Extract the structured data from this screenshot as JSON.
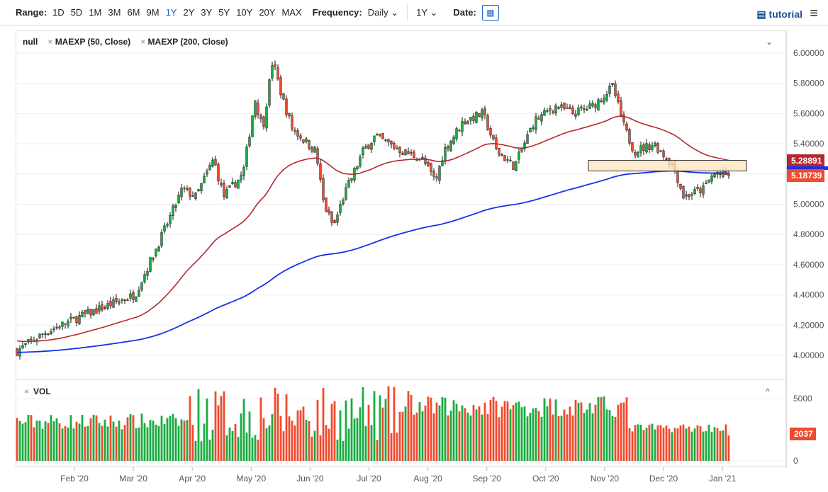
{
  "toolbar": {
    "range_label": "Range:",
    "ranges": [
      "1D",
      "5D",
      "1M",
      "3M",
      "6M",
      "9M",
      "1Y",
      "2Y",
      "3Y",
      "5Y",
      "10Y",
      "20Y",
      "MAX"
    ],
    "active_range": "1Y",
    "frequency_label": "Frequency:",
    "frequency": "Daily",
    "period": "1Y",
    "date_label": "Date:",
    "tutorial": "tutorial"
  },
  "legend": {
    "symbol": "null",
    "ma50": "MAEXP (50, Close)",
    "ma200": "MAEXP (200, Close)",
    "volume": "VOL"
  },
  "tags": {
    "ma50": "5.28891",
    "last": "5.18739",
    "volume": "2037"
  },
  "colors": {
    "up": "#1aab40",
    "down": "#f04a2f",
    "ma50": "#b5272d",
    "ma200": "#1533e8"
  },
  "chart_data": {
    "type": "candlestick",
    "y_ticks": [
      "6.00000",
      "5.80000",
      "5.60000",
      "5.40000",
      "5.20000",
      "5.00000",
      "4.80000",
      "4.60000",
      "4.40000",
      "4.20000",
      "4.00000"
    ],
    "ylim": [
      3.98,
      6.05
    ],
    "vol_ticks": [
      "5000",
      "0"
    ],
    "x_ticks": [
      "Feb '20",
      "Mar '20",
      "Apr '20",
      "May '20",
      "Jun '20",
      "Jul '20",
      "Aug '20",
      "Sep '20",
      "Oct '20",
      "Nov '20",
      "Dec '20",
      "Jan '21"
    ],
    "price_path_day_close": [
      [
        0,
        4.03
      ],
      [
        14,
        4.15
      ],
      [
        31,
        4.25
      ],
      [
        50,
        4.35
      ],
      [
        60,
        4.4
      ],
      [
        74,
        4.8
      ],
      [
        84,
        5.1
      ],
      [
        91,
        5.05
      ],
      [
        100,
        5.3
      ],
      [
        105,
        5.05
      ],
      [
        115,
        5.2
      ],
      [
        121,
        5.7
      ],
      [
        125,
        5.5
      ],
      [
        130,
        5.95
      ],
      [
        135,
        5.7
      ],
      [
        140,
        5.5
      ],
      [
        152,
        5.35
      ],
      [
        156,
        5.0
      ],
      [
        161,
        4.85
      ],
      [
        166,
        5.05
      ],
      [
        176,
        5.35
      ],
      [
        182,
        5.45
      ],
      [
        196,
        5.35
      ],
      [
        206,
        5.3
      ],
      [
        213,
        5.15
      ],
      [
        217,
        5.35
      ],
      [
        227,
        5.55
      ],
      [
        237,
        5.6
      ],
      [
        244,
        5.35
      ],
      [
        253,
        5.25
      ],
      [
        263,
        5.55
      ],
      [
        274,
        5.65
      ],
      [
        283,
        5.6
      ],
      [
        293,
        5.65
      ],
      [
        303,
        5.78
      ],
      [
        309,
        5.5
      ],
      [
        314,
        5.35
      ],
      [
        324,
        5.4
      ],
      [
        334,
        5.25
      ],
      [
        339,
        5.05
      ],
      [
        349,
        5.1
      ],
      [
        354,
        5.2
      ],
      [
        362,
        5.19
      ]
    ],
    "ma50_start": 4.1,
    "ma200_start": 4.02,
    "last_close": 5.18739,
    "last_volume": 2037,
    "zone": [
      5.22,
      5.29
    ]
  }
}
